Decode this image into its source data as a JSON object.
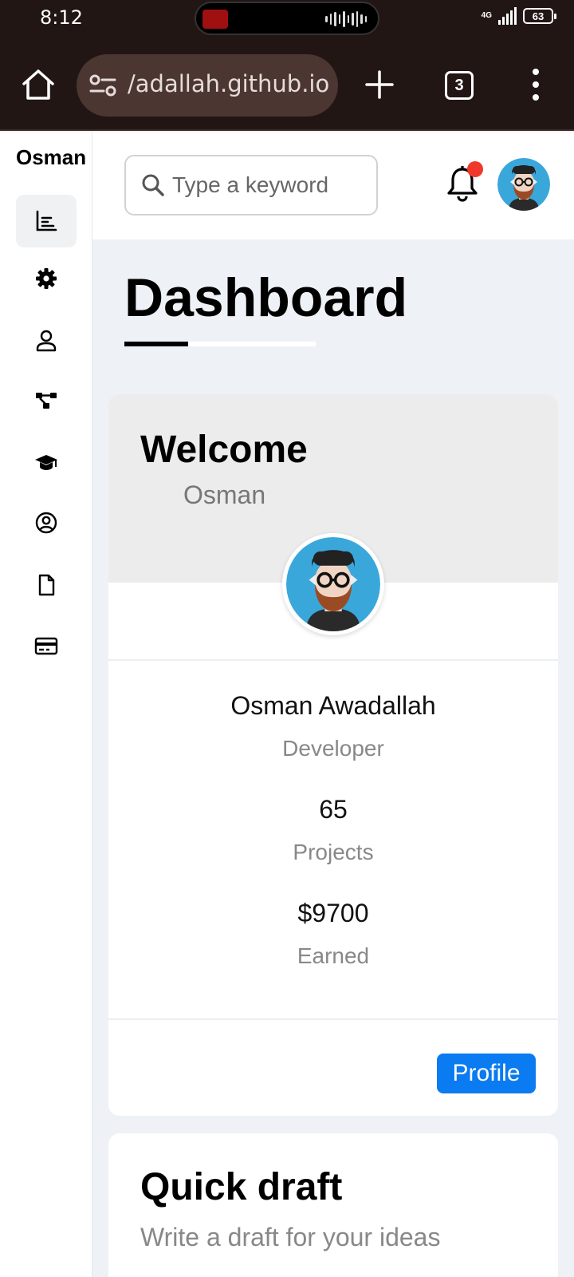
{
  "status_bar": {
    "time": "8:12",
    "network": "4G",
    "battery": "63"
  },
  "browser": {
    "url": "/adallah.github.io",
    "tab_count": "3"
  },
  "sidebar": {
    "brand": "Osman",
    "items": [
      {
        "name": "dashboard",
        "icon": "chart-icon",
        "active": true
      },
      {
        "name": "settings",
        "icon": "gear-icon"
      },
      {
        "name": "profile",
        "icon": "user-icon"
      },
      {
        "name": "projects",
        "icon": "diagram-icon"
      },
      {
        "name": "courses",
        "icon": "graduation-cap-icon"
      },
      {
        "name": "friends",
        "icon": "user-circle-icon"
      },
      {
        "name": "files",
        "icon": "file-icon"
      },
      {
        "name": "plans",
        "icon": "credit-card-icon"
      }
    ]
  },
  "header": {
    "search_placeholder": "Type a keyword"
  },
  "main": {
    "title": "Dashboard",
    "welcome_card": {
      "heading": "Welcome",
      "name": "Osman",
      "full_name": "Osman Awadallah",
      "role": "Developer",
      "projects_value": "65",
      "projects_label": "Projects",
      "earned_value": "$9700",
      "earned_label": "Earned",
      "profile_button": "Profile"
    },
    "quick_draft": {
      "title": "Quick draft",
      "subtitle": "Write a draft for your ideas"
    }
  },
  "colors": {
    "accent": "#0a7bf0",
    "notification": "#f0392b",
    "browser_bar": "#221615"
  }
}
